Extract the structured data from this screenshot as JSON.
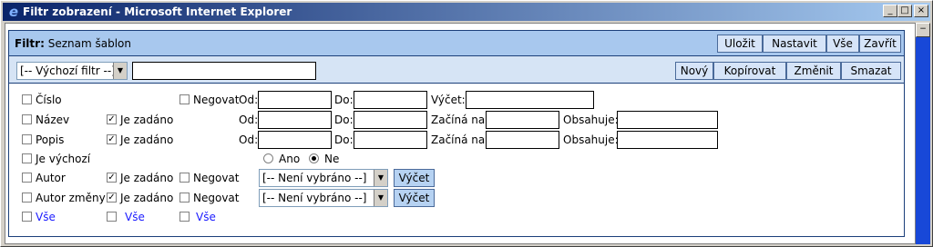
{
  "window": {
    "title": "Filtr zobrazení - Microsoft Internet Explorer",
    "controls": [
      "_",
      "□",
      "×"
    ]
  },
  "header": {
    "label": "Filtr:",
    "subtitle": "Seznam šablon",
    "buttons": [
      "Uložit",
      "Nastavit",
      "Vše",
      "Zavřít"
    ]
  },
  "toolbar": {
    "filter_select": "[-- Výchozí filtr --]",
    "filter_name": "",
    "buttons": [
      "Nový",
      "Kopírovat",
      "Změnit",
      "Smazat"
    ]
  },
  "rows": {
    "cislo": {
      "label": "Číslo",
      "negovat": "Negovat",
      "od": "Od:",
      "do": "Do:",
      "vycet": "Výčet:"
    },
    "nazev": {
      "label": "Název",
      "je_zadano": "Je zadáno",
      "od": "Od:",
      "do": "Do:",
      "zacina": "Začíná na:",
      "obsahuje": "Obsahuje:"
    },
    "popis": {
      "label": "Popis",
      "je_zadano": "Je zadáno",
      "od": "Od:",
      "do": "Do:",
      "zacina": "Začíná na:",
      "obsahuje": "Obsahuje:"
    },
    "je_vychozi": {
      "label": "Je výchozí",
      "ano": "Ano",
      "ne": "Ne"
    },
    "autor": {
      "label": "Autor",
      "je_zadano": "Je zadáno",
      "negovat": "Negovat",
      "select": "[-- Není vybráno --]",
      "vycet": "Výčet"
    },
    "autor_zmeny": {
      "label": "Autor změny",
      "je_zadano": "Je zadáno",
      "negovat": "Negovat",
      "select": "[-- Není vybráno --]",
      "vycet": "Výčet"
    }
  },
  "select_all": [
    "Vše",
    "Vše",
    "Vše"
  ]
}
